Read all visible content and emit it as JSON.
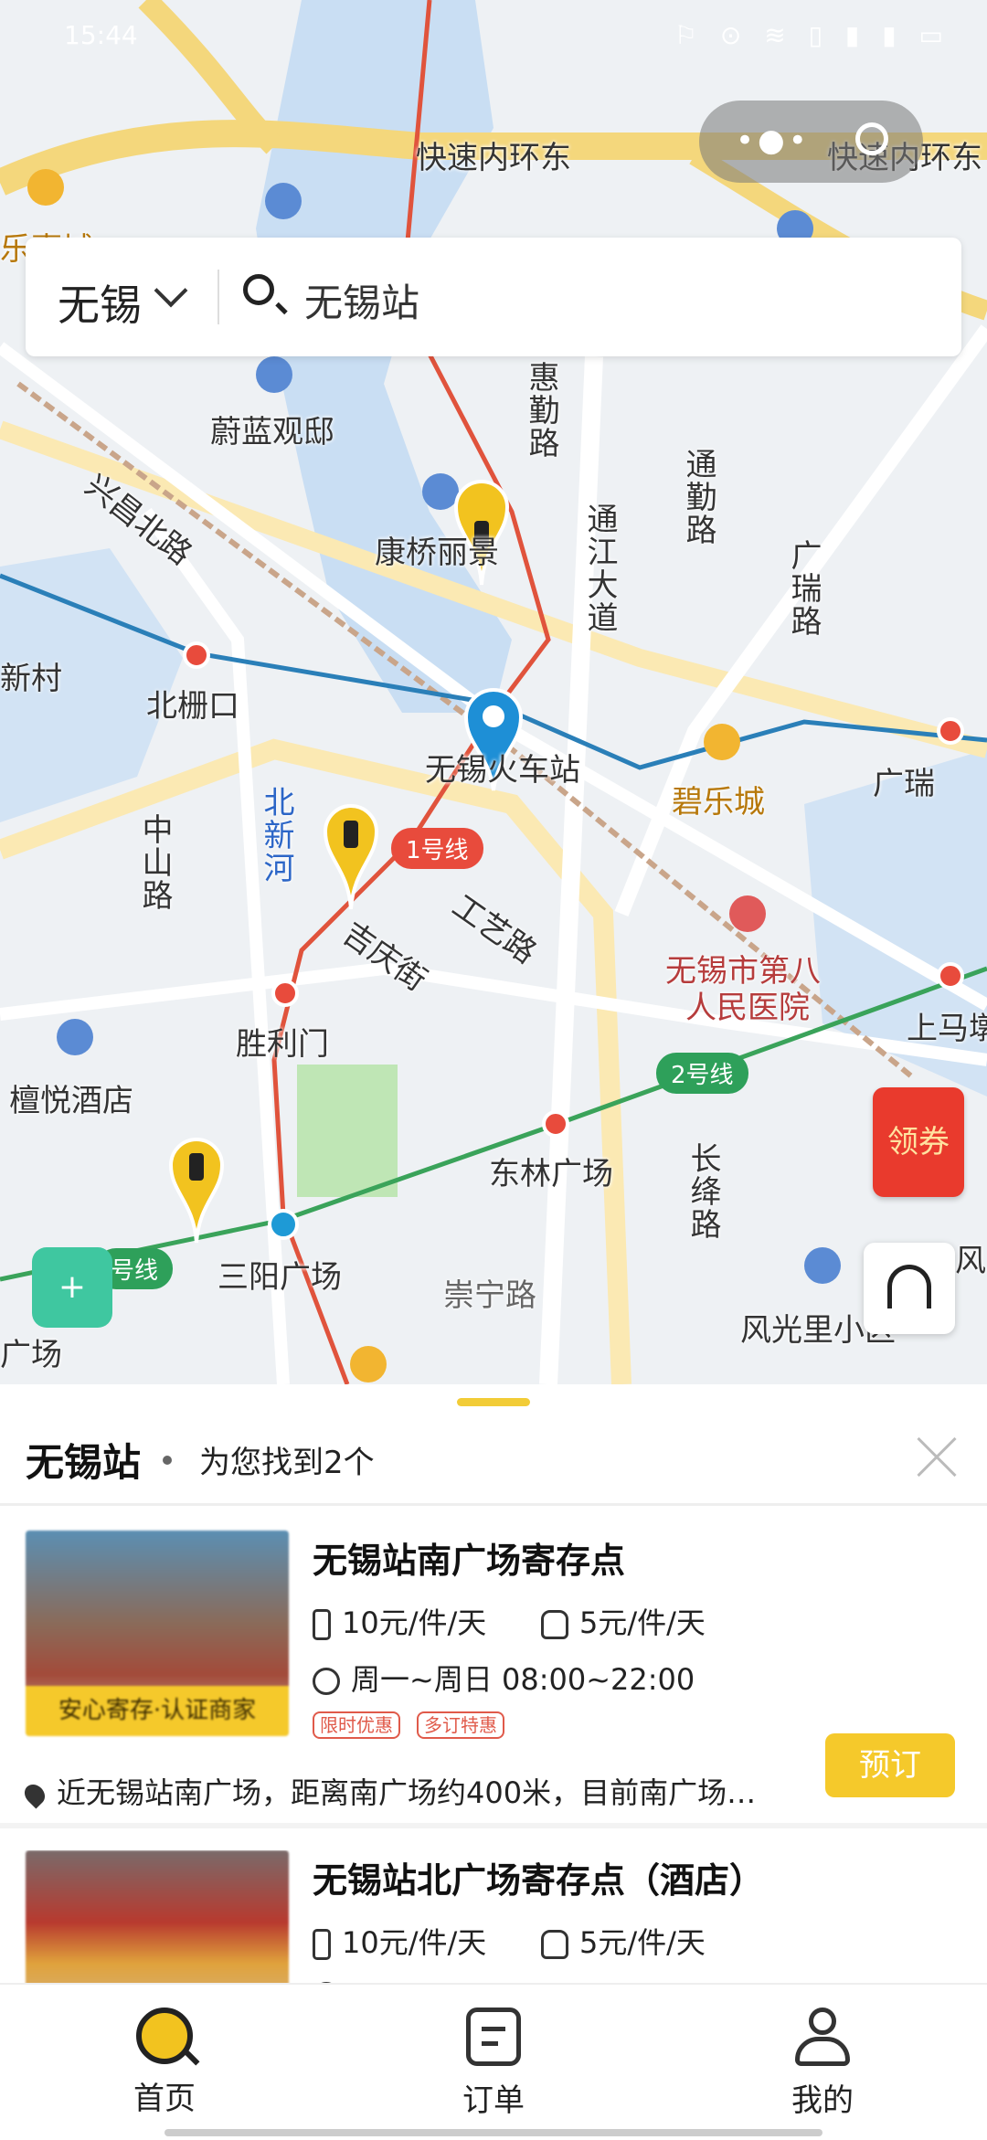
{
  "status_bar": {
    "time": "15:44",
    "icons": "⚐ ⊙ ≋ ▯ ▮ ▮ ▭"
  },
  "map": {
    "labels": {
      "ring_road_1": "快速内环东",
      "ring_road_2": "快速内环东",
      "mall_left": "乐嘉城",
      "weilan": "蔚蓝观邸",
      "xingchang": "兴昌北路",
      "huiqin": "惠勤路",
      "tongjiang": "通江大道",
      "tongqin": "通勤路",
      "kangqiao": "康桥丽景",
      "guangrui_road": "广瑞路",
      "xincun": "新村",
      "beishankou": "北栅口",
      "station": "无锡火车站",
      "bilecheng": "碧乐城",
      "guangrui": "广瑞",
      "zhongshan": "中山路",
      "beixinhe": "北新河",
      "jiqing": "吉庆街",
      "gongyi": "工艺路",
      "hospital_1": "无锡市第八",
      "hospital_2": "人民医院",
      "shanmatang": "上马墩",
      "shenglimen": "胜利门",
      "tanyue": "檀悦酒店",
      "donglin": "东林广场",
      "changjiang": "长绛路",
      "sanyang": "三阳广场",
      "chongning": "崇宁路",
      "fengguang": "风光里小区",
      "feng": "风",
      "guangchang": "广场"
    },
    "badges": {
      "line1": "1号线",
      "line2": "2号线",
      "line2_left": "号线"
    },
    "red_packet_label": "领券"
  },
  "search": {
    "city": "无锡",
    "query": "无锡站"
  },
  "results": {
    "title": "无锡站",
    "count_text": "为您找到2个",
    "items": [
      {
        "name": "无锡站南广场寄存点",
        "luggage_price": "10元/件/天",
        "bag_price": "5元/件/天",
        "hours": "周一~周日 08:00~22:00",
        "thumb_label": "安心寄存·认证商家",
        "tags": [
          "限时优惠",
          "多订特惠"
        ],
        "address": "近无锡站南广场，距离南广场约400米，目前南广场…",
        "book_label": "预订"
      },
      {
        "name": "无锡站北广场寄存点（酒店）",
        "luggage_price": "10元/件/天",
        "bag_price": "5元/件/天"
      }
    ]
  },
  "tabs": [
    {
      "label": "首页"
    },
    {
      "label": "订单"
    },
    {
      "label": "我的"
    }
  ],
  "colors": {
    "accent": "#f5c92b",
    "metro_red": "#e84b3c",
    "metro_green": "#2ea05a",
    "metro_blue": "#2a7fb8"
  }
}
